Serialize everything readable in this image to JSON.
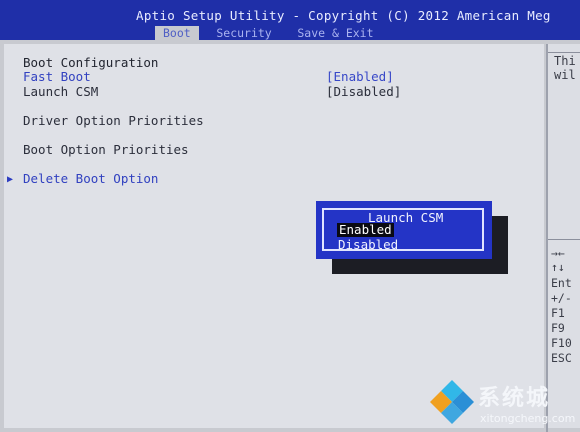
{
  "header": {
    "title": "Aptio Setup Utility - Copyright (C) 2012 American Meg",
    "tabs": [
      {
        "label": "Boot",
        "active": true
      },
      {
        "label": "Security",
        "active": false
      },
      {
        "label": "Save & Exit",
        "active": false
      }
    ]
  },
  "main": {
    "heading": "Boot Configuration",
    "fast_boot": {
      "label": "Fast Boot",
      "value": "[Enabled]"
    },
    "launch_csm": {
      "label": "Launch CSM",
      "value": "[Disabled]"
    },
    "driver_priorities": "Driver Option Priorities",
    "boot_priorities": "Boot Option Priorities",
    "delete_boot": {
      "arrow": "▶",
      "label": "Delete Boot Option"
    }
  },
  "help": {
    "line1": "Thi",
    "line2": "wil"
  },
  "keys": [
    "→←",
    "↑↓",
    "Ent",
    "+/-",
    "F1",
    "F9",
    "F10",
    "ESC"
  ],
  "popup": {
    "title": "Launch CSM",
    "options": [
      "Enabled",
      "Disabled"
    ],
    "highlighted": "Enabled"
  },
  "watermark": {
    "brand": "系统城",
    "url": "xitongcheng.com"
  },
  "colors": {
    "header_bg": "#1f2fa8",
    "panel_bg": "#dfe1e7",
    "value_blue": "#3848c8",
    "popup_bg": "#2434c6"
  }
}
